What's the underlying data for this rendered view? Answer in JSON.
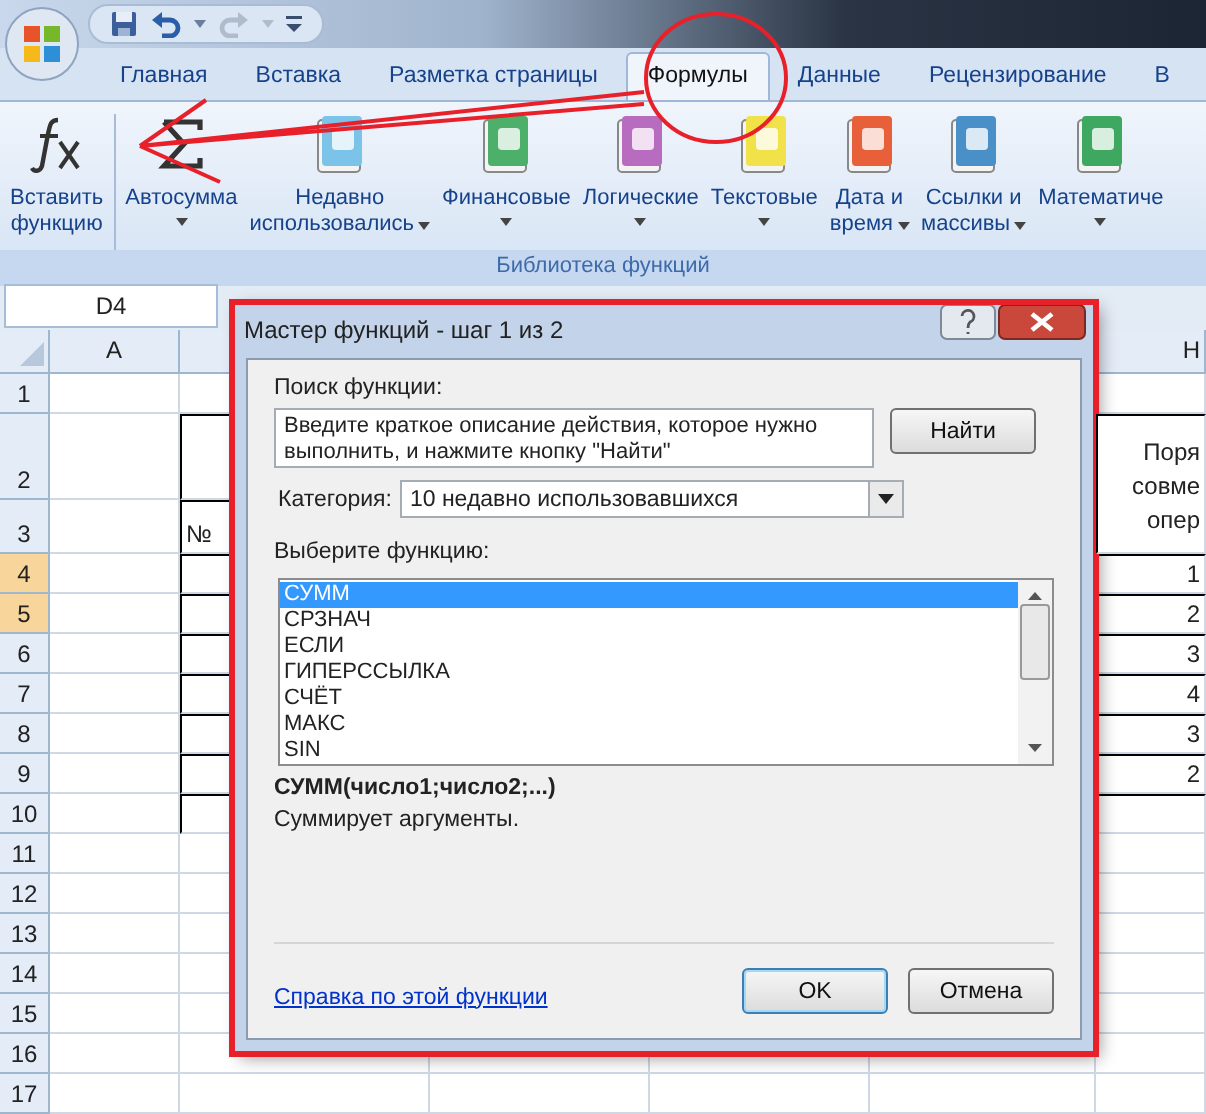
{
  "tabs": [
    {
      "label": "Главная",
      "selected": false
    },
    {
      "label": "Вставка",
      "selected": false
    },
    {
      "label": "Разметка страницы",
      "selected": false
    },
    {
      "label": "Формулы",
      "selected": true
    },
    {
      "label": "Данные",
      "selected": false
    },
    {
      "label": "Рецензирование",
      "selected": false
    },
    {
      "label": "В",
      "selected": false
    }
  ],
  "ribbon": {
    "group_label": "Библиотека функций",
    "buttons": [
      {
        "kind": "fx",
        "lines": [
          "Вставить",
          "функцию"
        ],
        "dropdown": false
      },
      {
        "kind": "sum",
        "lines": [
          "Автосумма"
        ],
        "dropdown": true
      },
      {
        "kind": "book",
        "color": "#7cc3ea",
        "lines": [
          "Недавно",
          "использовались"
        ],
        "dropdown": true
      },
      {
        "kind": "book",
        "color": "#4caf6a",
        "lines": [
          "Финансовые"
        ],
        "dropdown": true
      },
      {
        "kind": "book",
        "color": "#b86cc0",
        "lines": [
          "Логические"
        ],
        "dropdown": true
      },
      {
        "kind": "book",
        "color": "#f2e24a",
        "lines": [
          "Текстовые"
        ],
        "dropdown": true
      },
      {
        "kind": "book",
        "color": "#e8603a",
        "lines": [
          "Дата и",
          "время"
        ],
        "dropdown": true
      },
      {
        "kind": "book",
        "color": "#4a90c8",
        "lines": [
          "Ссылки и",
          "массивы"
        ],
        "dropdown": true
      },
      {
        "kind": "book",
        "color": "#3ea860",
        "lines": [
          "Математиче"
        ],
        "dropdown": true
      }
    ]
  },
  "name_box": "D4",
  "sheet": {
    "columns": [
      {
        "label": "A"
      },
      {
        "label": "H"
      }
    ],
    "h_header_lines": [
      "Поря",
      "совме",
      "опер"
    ],
    "rows": [
      {
        "label": "1",
        "selected": false
      },
      {
        "label": "2",
        "selected": false
      },
      {
        "label": "3",
        "selected": false,
        "b": "№"
      },
      {
        "label": "4",
        "selected": true,
        "h": "1"
      },
      {
        "label": "5",
        "selected": true,
        "h": "2"
      },
      {
        "label": "6",
        "selected": false,
        "h": "3"
      },
      {
        "label": "7",
        "selected": false,
        "h": "4"
      },
      {
        "label": "8",
        "selected": false,
        "h": "3"
      },
      {
        "label": "9",
        "selected": false,
        "h": "2"
      },
      {
        "label": "10",
        "selected": false
      },
      {
        "label": "11",
        "selected": false
      },
      {
        "label": "12",
        "selected": false
      },
      {
        "label": "13",
        "selected": false
      },
      {
        "label": "14",
        "selected": false
      },
      {
        "label": "15",
        "selected": false
      },
      {
        "label": "16",
        "selected": false
      },
      {
        "label": "17",
        "selected": false
      }
    ]
  },
  "dialog": {
    "title": "Мастер функций - шаг 1 из 2",
    "search_label": "Поиск функции:",
    "search_value": "Введите краткое описание действия, которое нужно выполнить, и нажмите кнопку \"Найти\"",
    "find_button": "Найти",
    "category_label": "Категория:",
    "category_value": "10 недавно использовавшихся",
    "list_label": "Выберите функцию:",
    "functions": [
      {
        "name": "СУММ",
        "selected": true
      },
      {
        "name": "СРЗНАЧ",
        "selected": false
      },
      {
        "name": "ЕСЛИ",
        "selected": false
      },
      {
        "name": "ГИПЕРССЫЛКА",
        "selected": false
      },
      {
        "name": "СЧЁТ",
        "selected": false
      },
      {
        "name": "МАКС",
        "selected": false
      },
      {
        "name": "SIN",
        "selected": false
      }
    ],
    "signature": "СУММ(число1;число2;...)",
    "description": "Суммирует аргументы.",
    "help_link": "Справка по этой функции",
    "buttons": [
      {
        "label": "OK",
        "default": true
      },
      {
        "label": "Отмена",
        "default": false
      }
    ]
  },
  "annotations": [
    {
      "kind": "circle",
      "color": "#e8202a"
    },
    {
      "kind": "arrow",
      "color": "#e8202a"
    },
    {
      "kind": "frame",
      "color": "#e8202a"
    }
  ]
}
